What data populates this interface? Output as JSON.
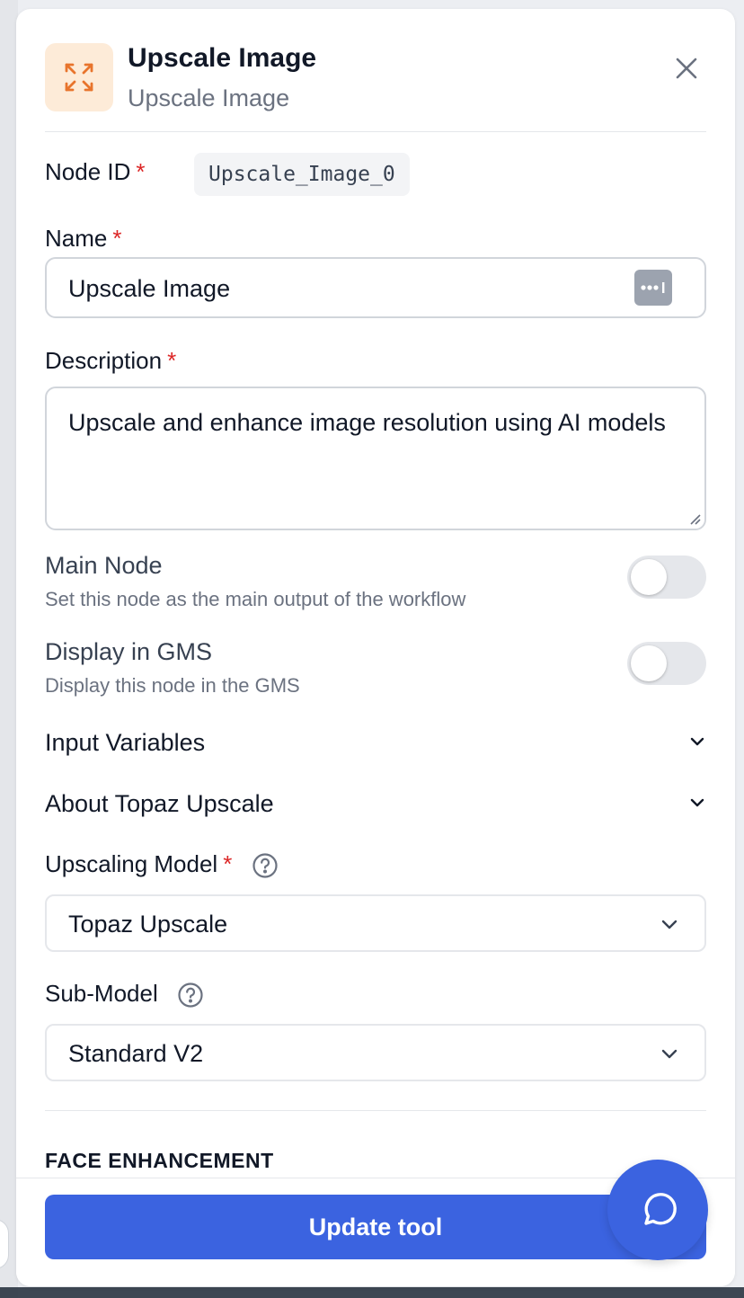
{
  "header": {
    "title": "Upscale Image",
    "subtitle": "Upscale Image",
    "icon": "expand-arrows-icon",
    "icon_color": "#e8742c",
    "icon_bg": "#fdebd8"
  },
  "fields": {
    "node_id": {
      "label": "Node ID",
      "required_mark": "*",
      "value": "Upscale_Image_0"
    },
    "name": {
      "label": "Name",
      "required_mark": "*",
      "value": "Upscale Image"
    },
    "description": {
      "label": "Description",
      "required_mark": "*",
      "value": "Upscale and enhance image resolution using AI models"
    }
  },
  "toggles": [
    {
      "title": "Main Node",
      "description": "Set this node as the main output of the workflow",
      "on": false
    },
    {
      "title": "Display in GMS",
      "description": "Display this node in the GMS",
      "on": false
    }
  ],
  "accordions": [
    {
      "label": "Input Variables",
      "expanded": false
    },
    {
      "label": "About Topaz Upscale",
      "expanded": false
    }
  ],
  "selects": {
    "upscaling_model": {
      "label": "Upscaling Model",
      "required_mark": "*",
      "value": "Topaz Upscale"
    },
    "sub_model": {
      "label": "Sub-Model",
      "value": "Standard V2"
    }
  },
  "section": {
    "heading": "FACE ENHANCEMENT"
  },
  "footer": {
    "update_label": "Update tool"
  },
  "colors": {
    "primary": "#3b63e0",
    "required": "#dc2626"
  }
}
